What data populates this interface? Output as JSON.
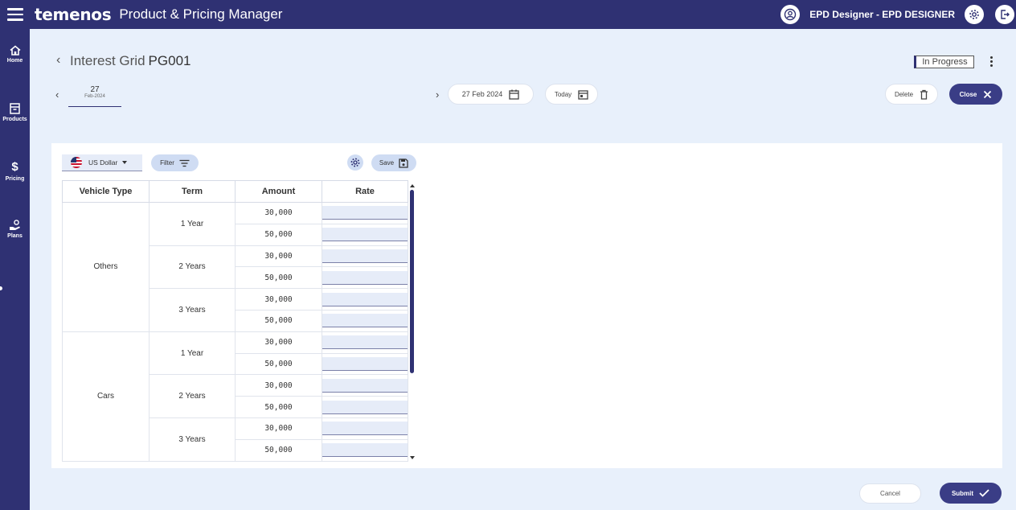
{
  "header": {
    "brand": "temenos",
    "app_title": "Product & Pricing Manager",
    "user": "EPD Designer - EPD DESIGNER"
  },
  "sidenav": {
    "items": [
      {
        "label": "Home",
        "icon": "home-icon"
      },
      {
        "label": "Products",
        "icon": "archive-box-icon"
      },
      {
        "label": "Pricing",
        "icon": "dollar-icon"
      },
      {
        "label": "Plans",
        "icon": "hand-coin-icon"
      }
    ]
  },
  "page": {
    "title": "Interest Grid",
    "code": "PG001",
    "status": "In Progress"
  },
  "datebar": {
    "day": "27",
    "month": "Feb-2024",
    "selected_date": "27 Feb 2024",
    "today_label": "Today",
    "delete_label": "Delete",
    "close_label": "Close"
  },
  "toolbar": {
    "currency": "US Dollar",
    "filter_label": "Filter",
    "save_label": "Save"
  },
  "table": {
    "headers": [
      "Vehicle Type",
      "Term",
      "Amount",
      "Rate"
    ],
    "groups": [
      {
        "vehicle": "Others",
        "terms": [
          {
            "term": "1 Year",
            "amounts": [
              "30,000",
              "50,000"
            ]
          },
          {
            "term": "2 Years",
            "amounts": [
              "30,000",
              "50,000"
            ]
          },
          {
            "term": "3 Years",
            "amounts": [
              "30,000",
              "50,000"
            ]
          }
        ]
      },
      {
        "vehicle": "Cars",
        "terms": [
          {
            "term": "1 Year",
            "amounts": [
              "30,000",
              "50,000"
            ]
          },
          {
            "term": "2 Years",
            "amounts": [
              "30,000",
              "50,000"
            ]
          },
          {
            "term": "3 Years",
            "amounts": [
              "30,000",
              "50,000"
            ]
          }
        ]
      }
    ]
  },
  "footer": {
    "cancel_label": "Cancel",
    "submit_label": "Submit"
  },
  "colors": {
    "brand_navy": "#2f3173",
    "button_dark": "#3a3d86",
    "page_bg": "#e8f0fb",
    "input_bg": "#e6ecf8"
  }
}
